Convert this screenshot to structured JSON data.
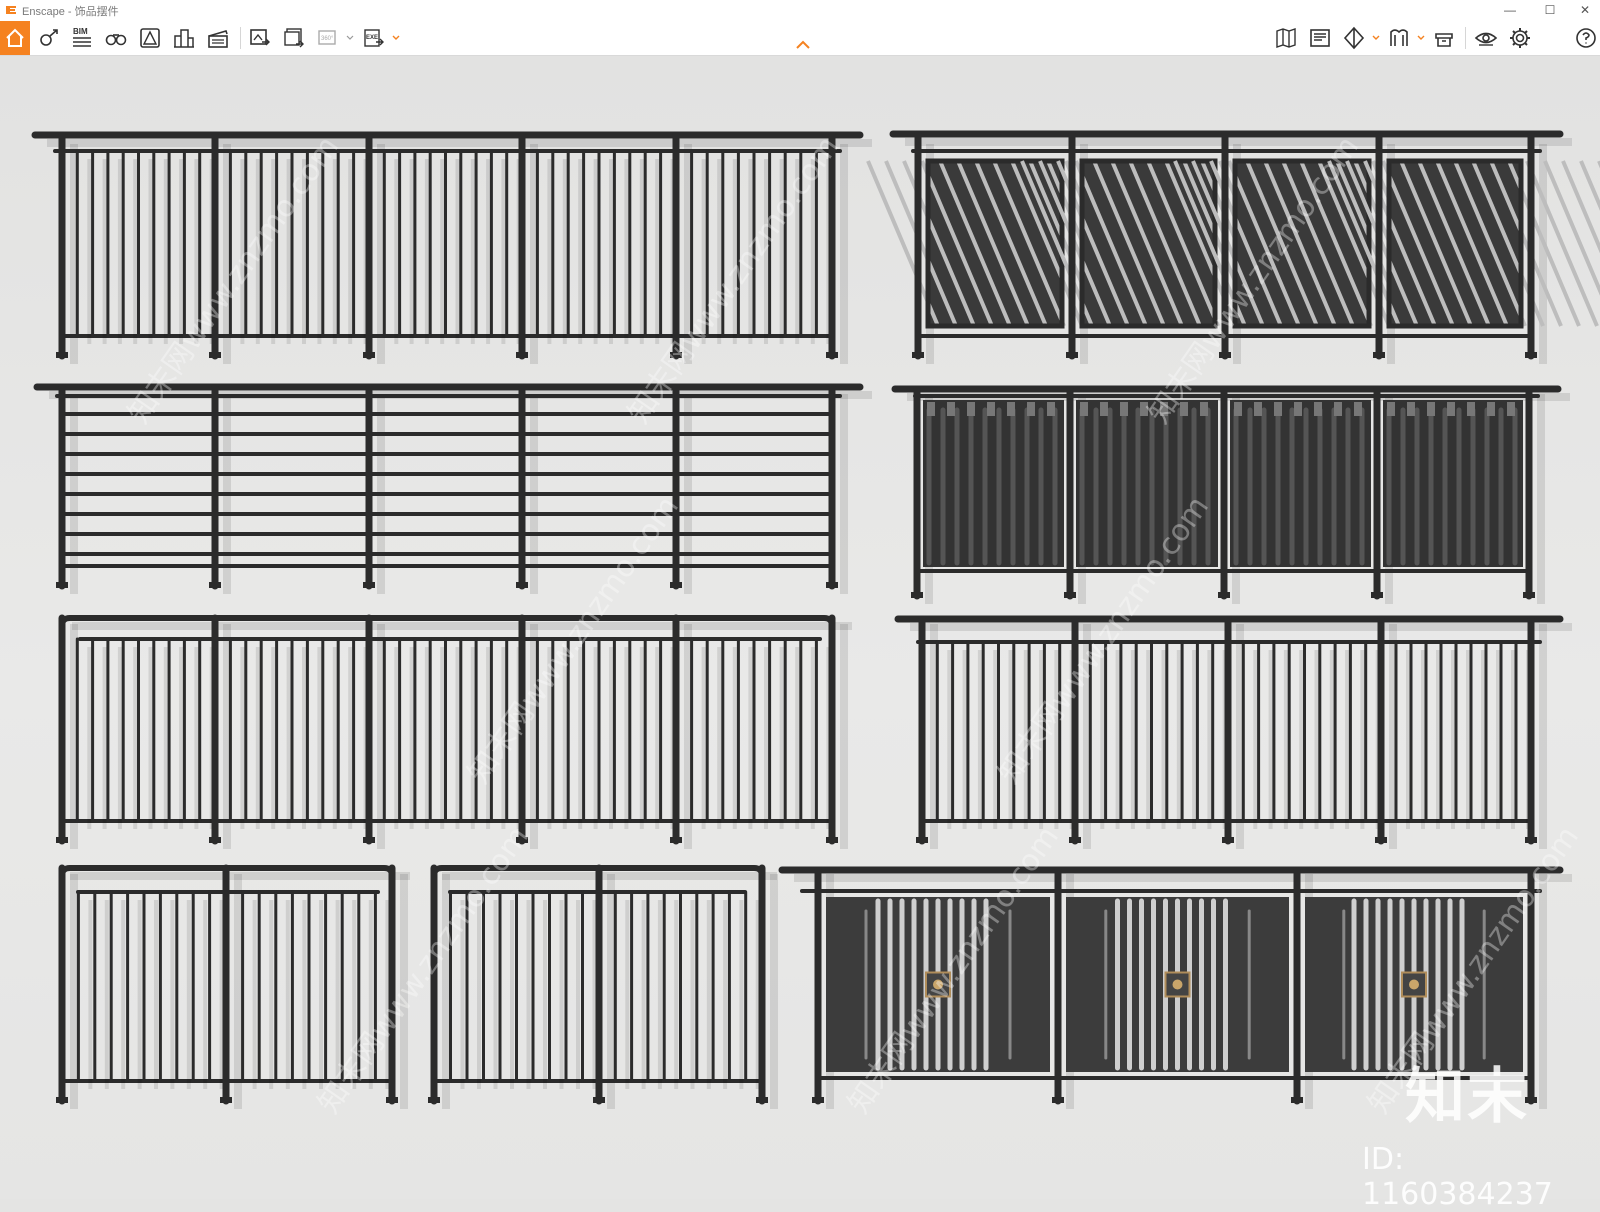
{
  "window": {
    "title": "Enscape - 饰品摆件"
  },
  "window_controls": {
    "minimize": "—",
    "maximize": "☐",
    "close": "✕"
  },
  "toolbar": {
    "bim_label": "BIM",
    "pano_label": "360°",
    "exe_label": "EXE",
    "left_icons": [
      "home-icon",
      "views-icon",
      "bim-icon",
      "binoculars-icon",
      "asset-library-icon",
      "buildings-icon",
      "video-editor-icon",
      "render-image-icon",
      "batch-render-icon",
      "panorama-icon",
      "export-exe-icon"
    ],
    "right_icons": [
      "map-icon",
      "info-icon",
      "material-icon",
      "atmosphere-icon",
      "upload-icon",
      "visual-settings-icon",
      "settings-icon",
      "help-icon"
    ]
  },
  "accent_color": "#f58220",
  "watermark": {
    "brand": "知末",
    "id_text": "ID: 1160384237",
    "site": "知末网www.znzmo.com"
  }
}
